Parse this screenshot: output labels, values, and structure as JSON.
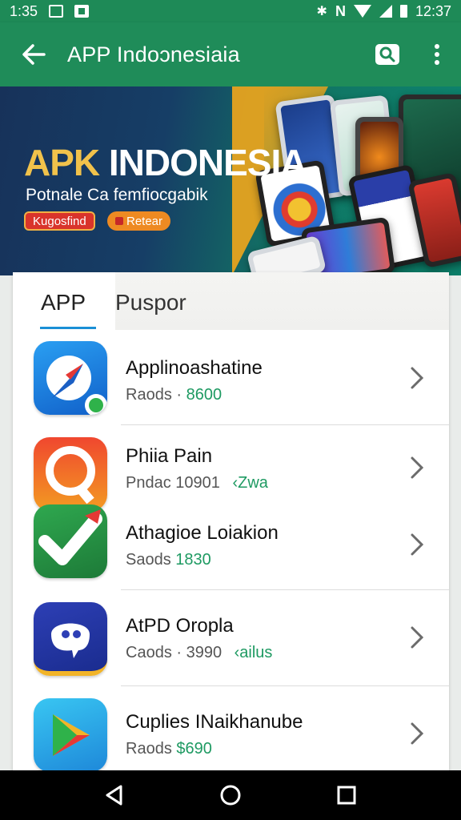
{
  "status_bar": {
    "time_left": "1:35",
    "time_right": "12:37"
  },
  "app_bar": {
    "title": "APP Indoɔnesiaia"
  },
  "banner": {
    "headline_part1": "APK",
    "headline_part2": "INDONESIA",
    "subtitle": "Potnale Ca femfiocgabik",
    "button_primary": "Kugosfind",
    "button_secondary": "Retear"
  },
  "tabs": [
    {
      "label": "APP"
    },
    {
      "label": "Puspor"
    }
  ],
  "apps": [
    {
      "name": "Applinoashatine",
      "meta_label": "Raods ·",
      "meta_value": "8600",
      "meta_tag": ""
    },
    {
      "name": "Phiia Pain",
      "meta_label": "Pndac 10901",
      "meta_value": "",
      "meta_tag": "‹Zwa"
    },
    {
      "name": "Athagioe Loiakion",
      "meta_label": "Saods",
      "meta_value": "1830",
      "meta_tag": ""
    },
    {
      "name": "AtPD Oropla",
      "meta_label": "Caods · 3990",
      "meta_value": "",
      "meta_tag": "‹ailus"
    },
    {
      "name": "Cuplies INaikhanube",
      "meta_label": "Raods",
      "meta_value": "$690",
      "meta_tag": ""
    }
  ],
  "colors": {
    "app_bar": "#1f8c59",
    "accent_green": "#1e9a62",
    "tab_indicator": "#1a8fd6"
  }
}
